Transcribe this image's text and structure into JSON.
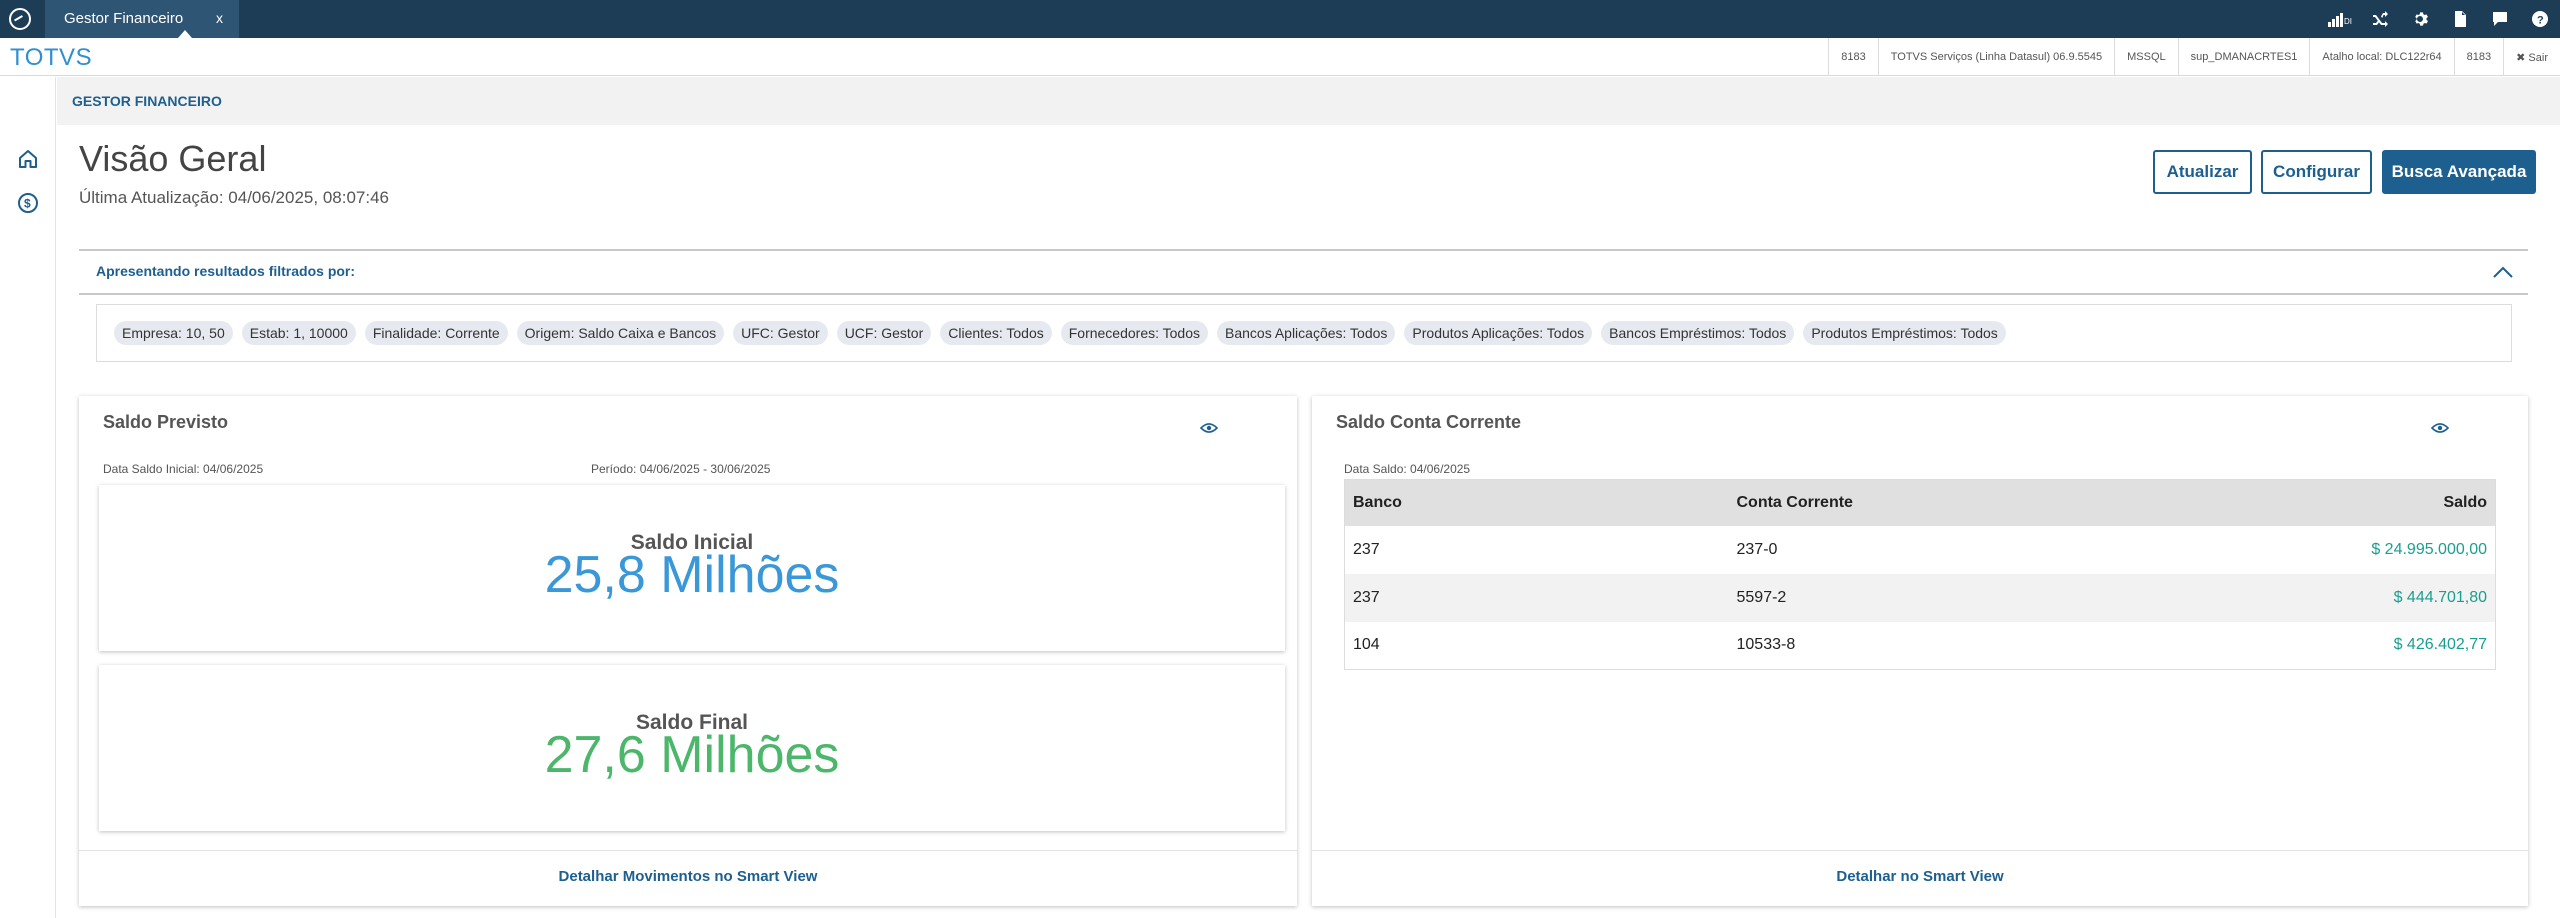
{
  "tab": {
    "label": "Gestor Financeiro",
    "close": "x"
  },
  "topbar_icons": [
    "signal-icon",
    "shuffle-icon",
    "gear-icon",
    "document-icon",
    "chat-icon",
    "help-icon"
  ],
  "topbar_signal_text": "DI",
  "brand": "TOTVS",
  "info": {
    "id1": "8183",
    "service": "TOTVS Serviços (Linha Datasul) 06.9.5545",
    "db": "MSSQL",
    "user": "sup_DMANACRTES1",
    "shortcut": "Atalho local: DLC122r64",
    "id2": "8183",
    "exit": "✖ Sair"
  },
  "breadcrumb": "GESTOR FINANCEIRO",
  "page": {
    "title": "Visão Geral",
    "last_update": "Última Atualização: 04/06/2025, 08:07:46"
  },
  "buttons": {
    "refresh": "Atualizar",
    "configure": "Configurar",
    "advanced_search": "Busca Avançada"
  },
  "filter": {
    "title": "Apresentando resultados filtrados por:",
    "chips": [
      "Empresa: 10, 50",
      "Estab: 1, 10000",
      "Finalidade: Corrente",
      "Origem: Saldo Caixa e Bancos",
      "UFC: Gestor",
      "UCF: Gestor",
      "Clientes: Todos",
      "Fornecedores: Todos",
      "Bancos Aplicações: Todos",
      "Produtos Aplicações: Todos",
      "Bancos Empréstimos: Todos",
      "Produtos Empréstimos: Todos"
    ]
  },
  "saldo_previsto": {
    "title": "Saldo Previsto",
    "data_inicial": "Data Saldo Inicial: 04/06/2025",
    "periodo": "Período: 04/06/2025 - 30/06/2025",
    "inicial_label": "Saldo Inicial",
    "inicial_value": "25,8 Milhões",
    "final_label": "Saldo Final",
    "final_value": "27,6 Milhões",
    "footer_link": "Detalhar Movimentos no Smart View",
    "colors": {
      "inicial": "#3a97d8",
      "final": "#4cb76b"
    }
  },
  "saldo_conta": {
    "title": "Saldo Conta Corrente",
    "data_saldo": "Data Saldo: 04/06/2025",
    "columns": [
      "Banco",
      "Conta Corrente",
      "Saldo"
    ],
    "rows": [
      {
        "banco": "237",
        "conta": "237-0",
        "saldo": "$ 24.995.000,00"
      },
      {
        "banco": "237",
        "conta": "5597-2",
        "saldo": "$ 444.701,80"
      },
      {
        "banco": "104",
        "conta": "10533-8",
        "saldo": "$ 426.402,77"
      }
    ],
    "footer_link": "Detalhar no Smart View"
  }
}
